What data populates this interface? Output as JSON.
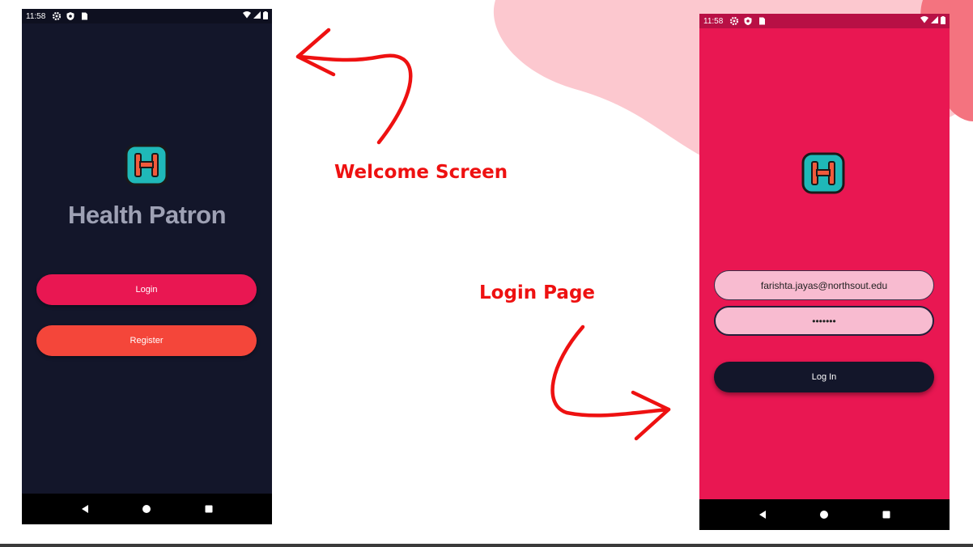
{
  "status_bar": {
    "time": "11:58"
  },
  "welcome_screen": {
    "app_title": "Health Patron",
    "login_button": "Login",
    "register_button": "Register"
  },
  "login_page": {
    "email_value": "farishta.jayas@northsout.edu",
    "password_value": "•••••••",
    "submit_button": "Log In"
  },
  "captions": {
    "welcome": "Welcome Screen",
    "login": "Login Page"
  },
  "icons": {
    "status": [
      "gear-icon",
      "shield-icon",
      "sim-card-icon",
      "wifi-icon",
      "signal-icon",
      "battery-icon"
    ],
    "nav": [
      "back-icon",
      "home-icon",
      "recents-icon"
    ],
    "logo": "health-patron-logo-icon"
  },
  "colors": {
    "welcome_bg": "#13162a",
    "primary_pink": "#e91752",
    "register_red": "#f4463a",
    "field_pink": "#f8bbd0",
    "logo_teal": "#1fb8b8",
    "logo_letter": "#f05a3c",
    "caption_red": "#ee1111",
    "blob_light": "#fcc8cf",
    "blob_dark": "#f4737f"
  }
}
